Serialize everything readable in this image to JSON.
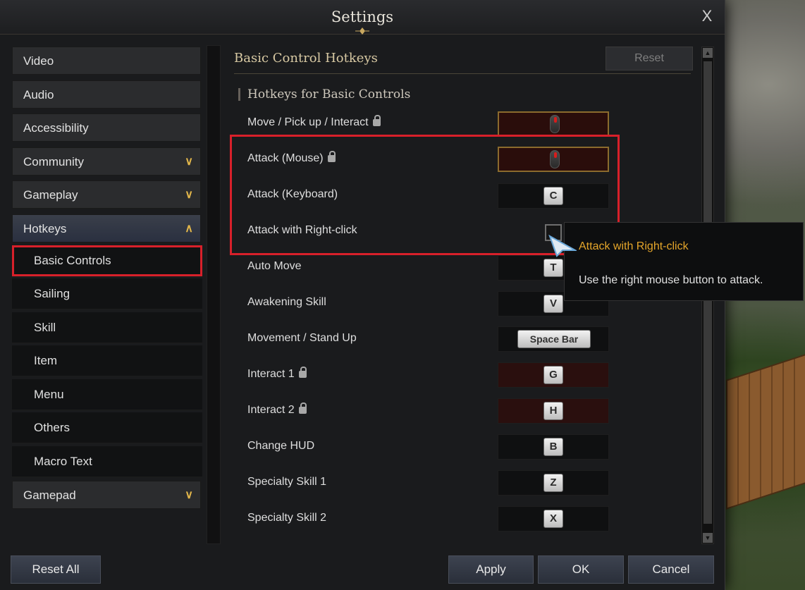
{
  "window": {
    "title": "Settings",
    "close_label": "X"
  },
  "sidebar": {
    "categories": [
      {
        "label": "Video"
      },
      {
        "label": "Audio"
      },
      {
        "label": "Accessibility"
      },
      {
        "label": "Community"
      },
      {
        "label": "Gameplay"
      },
      {
        "label": "Hotkeys"
      },
      {
        "label": "Gamepad"
      }
    ],
    "hotkey_subitems": [
      {
        "label": "Basic Controls"
      },
      {
        "label": "Sailing"
      },
      {
        "label": "Skill"
      },
      {
        "label": "Item"
      },
      {
        "label": "Menu"
      },
      {
        "label": "Others"
      },
      {
        "label": "Macro Text"
      }
    ],
    "selected": "Basic Controls"
  },
  "main": {
    "title": "Basic Control Hotkeys",
    "reset_label": "Reset",
    "section_title": "Hotkeys for Basic Controls",
    "rows": [
      {
        "label": "Move / Pick up / Interact",
        "binding": "mouse",
        "locked": true
      },
      {
        "label": "Attack (Mouse)",
        "binding": "mouse",
        "locked": true
      },
      {
        "label": "Attack (Keyboard)",
        "binding": "C",
        "locked": false
      },
      {
        "label": "Attack with Right-click",
        "binding": "checkbox",
        "checked": false
      },
      {
        "label": "Auto Move",
        "binding": "T",
        "locked": false
      },
      {
        "label": "Awakening Skill",
        "binding": "V",
        "locked": false
      },
      {
        "label": "Movement / Stand Up",
        "binding": "Space Bar",
        "locked": false
      },
      {
        "label": "Interact 1",
        "binding": "G",
        "locked": true
      },
      {
        "label": "Interact 2",
        "binding": "H",
        "locked": true
      },
      {
        "label": "Change HUD",
        "binding": "B",
        "locked": false
      },
      {
        "label": "Specialty Skill 1",
        "binding": "Z",
        "locked": false
      },
      {
        "label": "Specialty Skill 2",
        "binding": "X",
        "locked": false
      }
    ]
  },
  "tooltip": {
    "title": "Attack with Right-click",
    "description": "Use the right mouse button to attack."
  },
  "footer": {
    "reset_all": "Reset All",
    "apply": "Apply",
    "ok": "OK",
    "cancel": "Cancel"
  },
  "colors": {
    "accent_gold": "#e0b54a",
    "highlight_red": "#d8202a",
    "tooltip_title": "#e4a52a"
  },
  "icons": {
    "lock": "lock-icon",
    "expand": "chevron-down-icon",
    "collapse": "chevron-up-icon",
    "mouse": "mouse-icon"
  }
}
